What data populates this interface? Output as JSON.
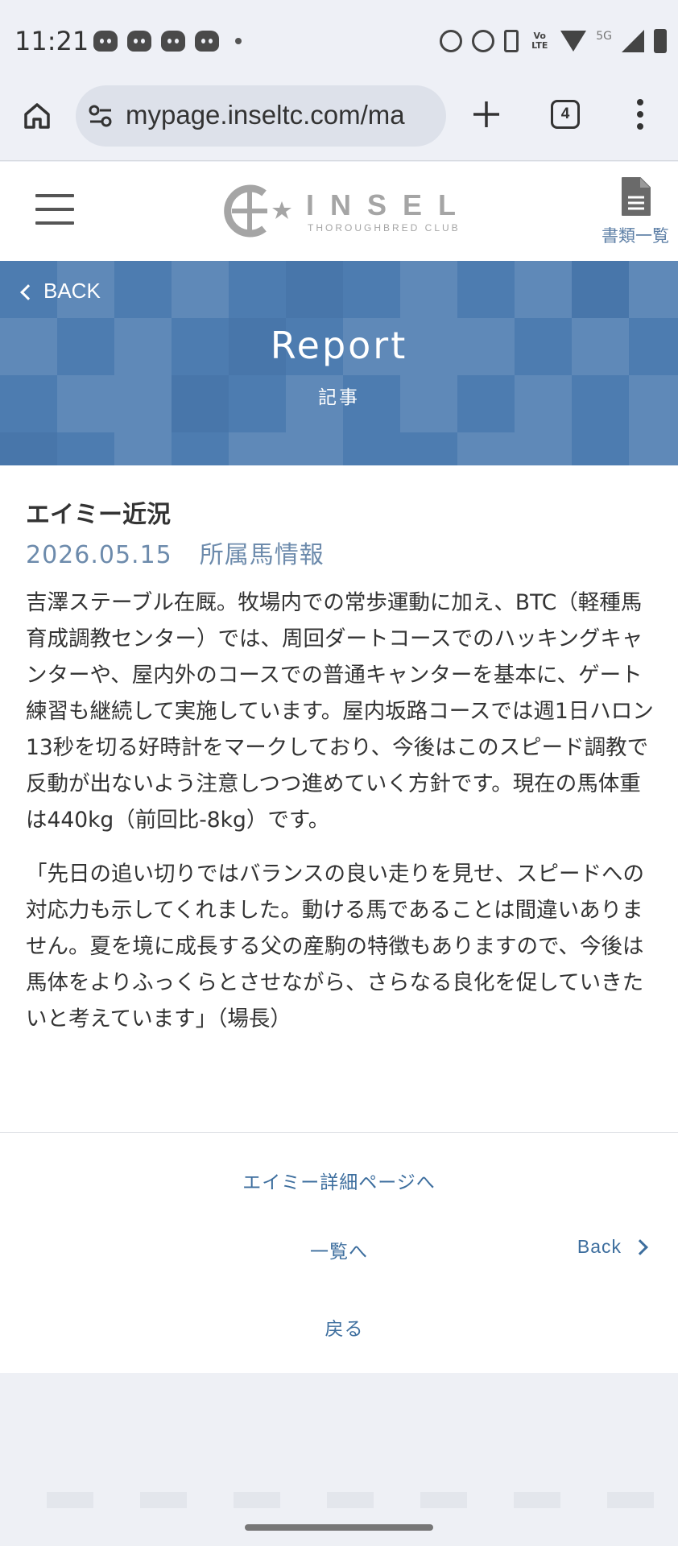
{
  "status_bar": {
    "time": "11:21",
    "icons": [
      "discord-icon",
      "discord-icon",
      "discord-icon",
      "discord-icon",
      "dot-icon",
      "alarm-icon",
      "data-saver-icon",
      "vibrate-icon",
      "volte-icon",
      "wifi-icon",
      "5g-icon",
      "signal-icon",
      "battery-icon"
    ],
    "lte_label": "Vo LTE",
    "network_label": "5G"
  },
  "browser": {
    "url": "mypage.inseltc.com/ma",
    "tab_count": "4"
  },
  "site_header": {
    "logo_text": "INSEL",
    "logo_sub": "THOROUGHBRED CLUB",
    "docs_label": "書類一覧"
  },
  "banner": {
    "back_label": "BACK",
    "title": "Report",
    "subtitle": "記事"
  },
  "article": {
    "title": "エイミー近況",
    "date": "2026.05.15",
    "category": "所属馬情報",
    "paragraphs": [
      "吉澤ステーブル在厩。牧場内での常歩運動に加え、BTC（軽種馬育成調教センター）では、周回ダートコースでのハッキングキャンターや、屋内外のコースでの普通キャンターを基本に、ゲート練習も継続して実施しています。屋内坂路コースでは週1日ハロン13秒を切る好時計をマークしており、今後はこのスピード調教で反動が出ないよう注意しつつ進めていく方針です。現在の馬体重は440kg（前回比-8kg）です。",
      "「先日の追い切りではバランスの良い走りを見せ、スピードへの対応力も示してくれました。動ける馬であることは間違いありません。夏を境に成長する父の産駒の特徴もありますので、今後は馬体をよりふっくらとさせながら、さらなる良化を促していきたいと考えています」（場長）"
    ]
  },
  "links": {
    "detail": "エイミー詳細ページへ",
    "list": "一覧へ",
    "back": "Back",
    "return": "戻る"
  },
  "colors": {
    "banner": "#4d7cb0",
    "link": "#3d6e9e",
    "meta": "#6d8bac"
  }
}
